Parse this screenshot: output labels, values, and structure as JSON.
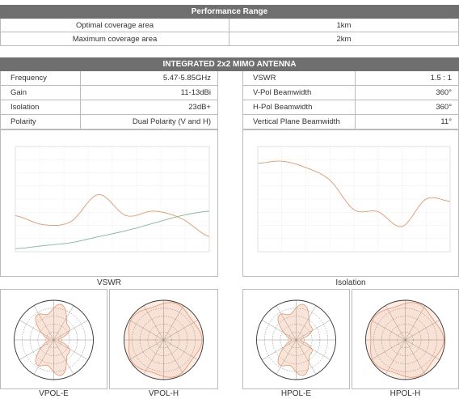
{
  "performance": {
    "title": "Performance Range",
    "rows": [
      {
        "label": "Optimal coverage area",
        "value": "1km"
      },
      {
        "label": "Maximum coverage area",
        "value": "2km"
      }
    ]
  },
  "antenna": {
    "title": "INTEGRATED 2x2 MIMO ANTENNA",
    "left": [
      {
        "label": "Frequency",
        "value": "5.47-5.85GHz"
      },
      {
        "label": "Gain",
        "value": "11-13dBi"
      },
      {
        "label": "Isolation",
        "value": "23dB+"
      },
      {
        "label": "Polarity",
        "value": "Dual Polarity (V and H)"
      }
    ],
    "right": [
      {
        "label": "VSWR",
        "value": "1.5 : 1"
      },
      {
        "label": "V-Pol Beamwidth",
        "value": "360°"
      },
      {
        "label": "H-Pol Beamwidth",
        "value": "360°"
      },
      {
        "label": "Vertical Plane Beamwidth",
        "value": "11°"
      }
    ]
  },
  "charts": {
    "vswr_caption": "VSWR",
    "isolation_caption": "Isolation",
    "patterns": [
      "VPOL-E",
      "VPOL-H",
      "HPOL-E",
      "HPOL-H"
    ]
  },
  "chart_data": [
    {
      "type": "line",
      "title": "",
      "series": [
        {
          "values": [
            2.2,
            1.9,
            2.0,
            2.9,
            2.2,
            2.35,
            2.1,
            1.5
          ]
        },
        {
          "values": [
            1.1,
            1.2,
            1.3,
            1.5,
            1.7,
            1.95,
            2.2,
            2.35
          ]
        }
      ],
      "colors": [
        "#e8956a",
        "#7fb89c"
      ]
    },
    {
      "type": "line",
      "title": "",
      "series": [
        {
          "values": [
            -18,
            -17,
            -20,
            -26,
            -40,
            -41,
            -48,
            -35,
            -36
          ]
        }
      ],
      "colors": [
        "#e8956a"
      ]
    }
  ],
  "colors": {
    "header": "#6f6f6f",
    "border": "#bbbbbb",
    "orange": "#e8956a",
    "green": "#7fb89c"
  }
}
